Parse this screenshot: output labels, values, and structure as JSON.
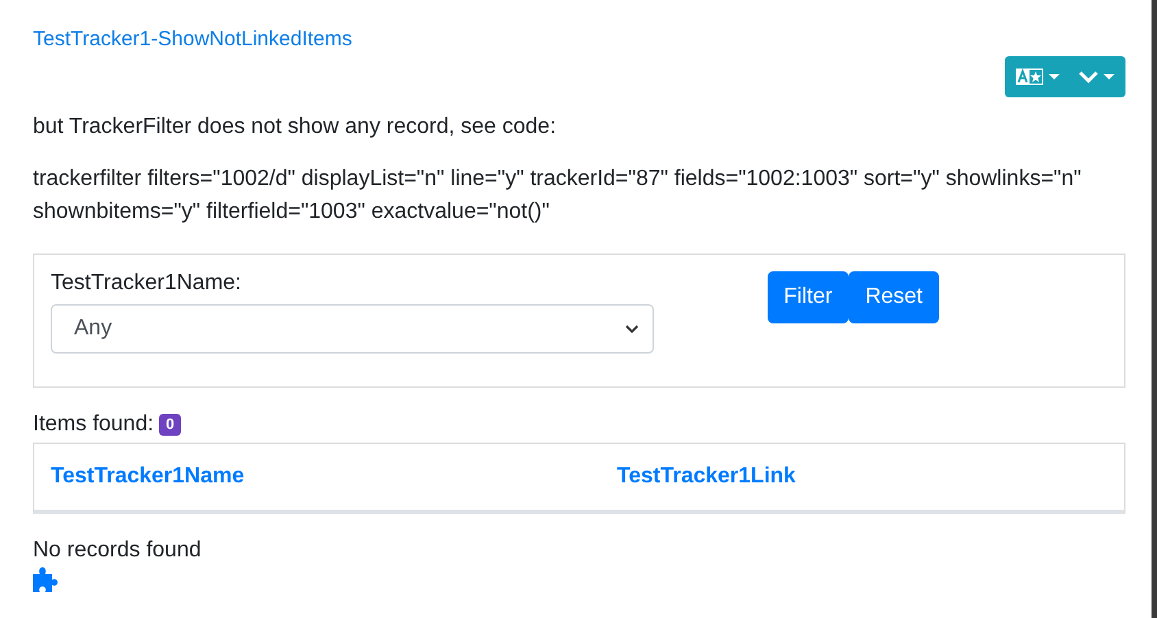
{
  "title": "TestTracker1-ShowNotLinkedItems",
  "intro": "but TrackerFilter does not show any record, see code:",
  "code": "trackerfilter filters=\"1002/d\" displayList=\"n\" line=\"y\" trackerId=\"87\" fields=\"1002:1003\" sort=\"y\" showlinks=\"n\" shownbitems=\"y\" filterfield=\"1003\" exactvalue=\"not()\"",
  "filter": {
    "label": "TestTracker1Name:",
    "select_value": "Any",
    "buttons": [
      "Filter",
      "Reset"
    ]
  },
  "items_found": {
    "label": "Items found:",
    "count": "0"
  },
  "table": {
    "columns": [
      "TestTracker1Name",
      "TestTracker1Link"
    ]
  },
  "empty_message": "No records found"
}
